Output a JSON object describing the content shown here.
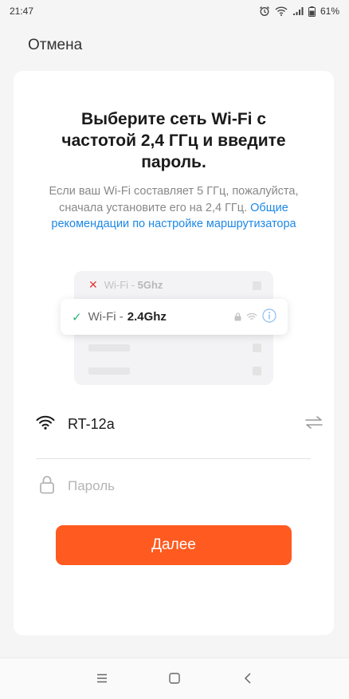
{
  "status_bar": {
    "time": "21:47",
    "battery": "61%",
    "icons": [
      "alarm-icon",
      "wifi-icon",
      "signal-icon",
      "battery-icon"
    ]
  },
  "header": {
    "cancel_label": "Отмена"
  },
  "card": {
    "title": "Выберите сеть Wi-Fi с частотой 2,4 ГГц и введите пароль.",
    "description": "Если ваш Wi-Fi составляет 5 ГГц, пожалуйста, сначала установите его на 2,4 ГГц.",
    "link_text": "Общие рекомендации по настройке маршрутизатора",
    "illustration": {
      "bad_network_prefix": "Wi-Fi -",
      "bad_network_freq": "5Ghz",
      "good_network_prefix": "Wi-Fi -",
      "good_network_freq": "2.4Ghz"
    },
    "wifi_name": "RT-12a",
    "password_placeholder": "Пароль",
    "next_label": "Далее"
  },
  "colors": {
    "accent": "#ff5a1f",
    "link": "#1e88e5",
    "check": "#2bb673",
    "cross": "#e53935"
  }
}
